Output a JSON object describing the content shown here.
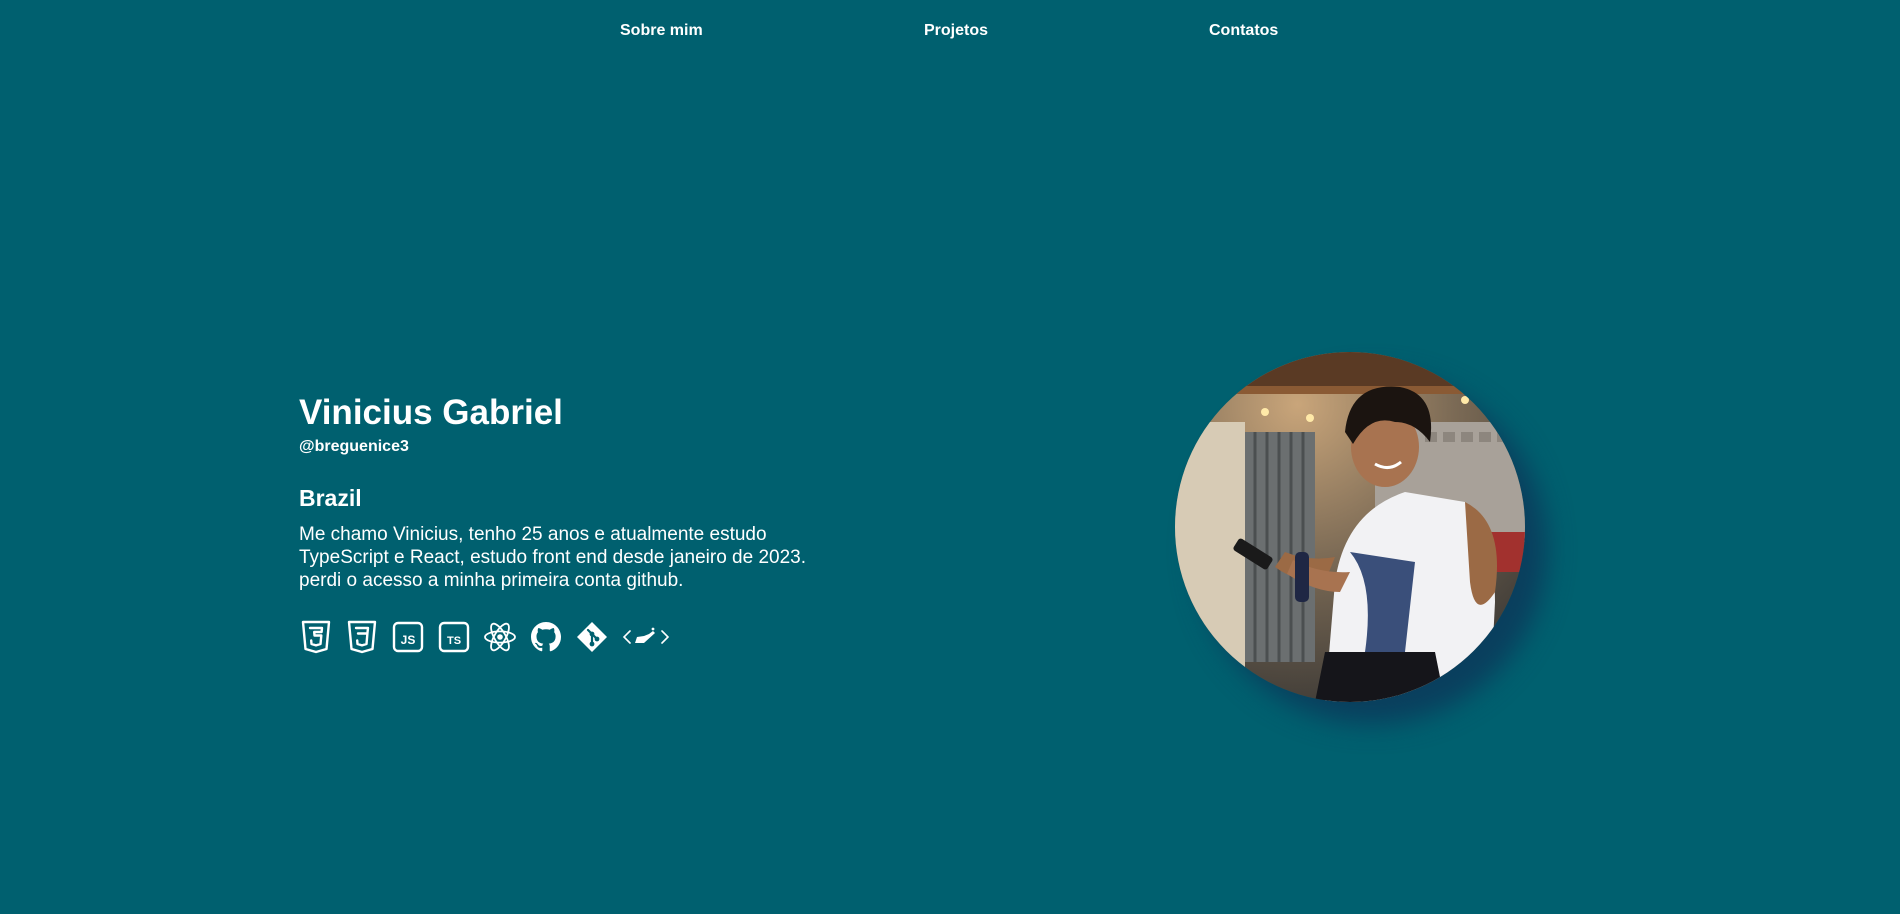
{
  "nav": {
    "items": [
      {
        "label": "Sobre mim"
      },
      {
        "label": "Projetos"
      },
      {
        "label": "Contatos"
      }
    ]
  },
  "profile": {
    "name": "Vinicius Gabriel",
    "handle": "@breguenice3",
    "country": "Brazil",
    "bio": "Me chamo Vinicius, tenho 25 anos e atualmente estudo TypeScript e React, estudo front end desde janeiro de 2023. perdi o acesso a minha primeira conta github."
  },
  "techs": [
    {
      "icon": "html5-icon"
    },
    {
      "icon": "css3-icon"
    },
    {
      "icon": "javascript-icon"
    },
    {
      "icon": "typescript-icon"
    },
    {
      "icon": "react-icon"
    },
    {
      "icon": "github-icon"
    },
    {
      "icon": "git-icon"
    },
    {
      "icon": "vscode-icon"
    }
  ],
  "colors": {
    "background": "#00606f",
    "text": "#ffffff",
    "shadow": "#0a3f5e"
  }
}
